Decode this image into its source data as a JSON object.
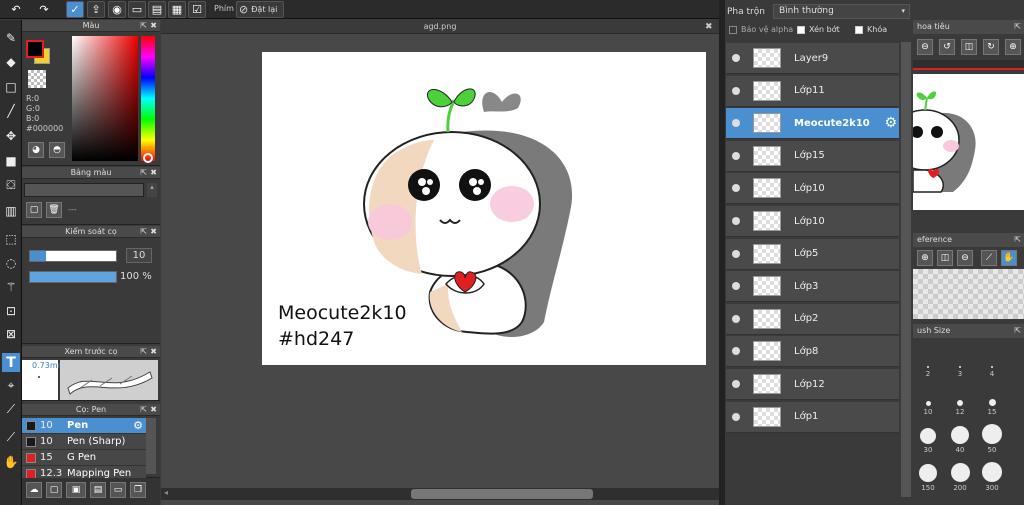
{
  "toolbar": {
    "shortcut_label": "Phím",
    "reset_label": "Đặt lại"
  },
  "color_panel": {
    "title": "Màu",
    "r": "R:0",
    "g": "G:0",
    "b": "B:0",
    "hex": "#000000"
  },
  "palette_panel": {
    "title": "Bảng màu",
    "item_text": "---"
  },
  "brush_control": {
    "title": "Kiểm soát cọ",
    "size": "10",
    "opacity": "100 %"
  },
  "preview_panel": {
    "title": "Xem trước cọ",
    "size_text": "0.73mm"
  },
  "brush_panel": {
    "title": "Cọ: Pen",
    "items": [
      {
        "size": "10",
        "name": "Pen",
        "color": "#1a1a1a"
      },
      {
        "size": "10",
        "name": "Pen (Sharp)",
        "color": "#1a1a1a"
      },
      {
        "size": "15",
        "name": "G Pen",
        "color": "#e02020"
      },
      {
        "size": "12.3",
        "name": "Mapping Pen",
        "color": "#e02020"
      }
    ]
  },
  "document": {
    "tab": "agd.png",
    "text_line1": "Meocute2k10",
    "text_line2": "#hd247"
  },
  "layers": {
    "blend_label": "Pha trộn",
    "blend_mode": "Bình thường",
    "protect_alpha": "Bảo vệ alpha",
    "clipping": "Xén bớt",
    "lock": "Khóa",
    "items": [
      {
        "name": "Layer9"
      },
      {
        "name": "Lớp11"
      },
      {
        "name": "Meocute2k10",
        "selected": true
      },
      {
        "name": "Lớp15"
      },
      {
        "name": "Lớp10"
      },
      {
        "name": "Lớp10"
      },
      {
        "name": "Lớp5"
      },
      {
        "name": "Lớp3"
      },
      {
        "name": "Lớp2"
      },
      {
        "name": "Lớp8"
      },
      {
        "name": "Lớp12"
      },
      {
        "name": "Lớp1"
      }
    ]
  },
  "navigator": {
    "title": "hoa tiêu"
  },
  "reference": {
    "title": "eference"
  },
  "brush_size": {
    "title": "ush Size",
    "sizes": [
      "2",
      "3",
      "4",
      "10",
      "12",
      "15",
      "30",
      "40",
      "50",
      "150",
      "200",
      "300"
    ]
  }
}
